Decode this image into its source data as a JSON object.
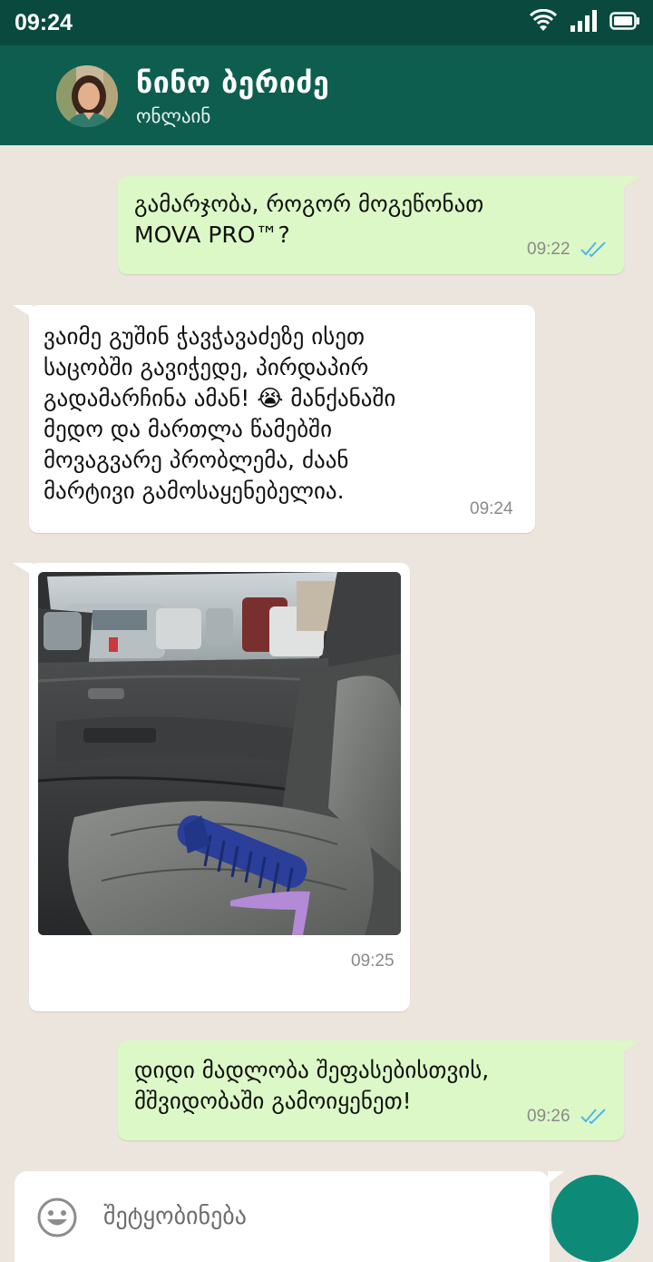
{
  "status_bar": {
    "time": "09:24",
    "icons": [
      "wifi-icon",
      "signal-icon",
      "battery-icon"
    ]
  },
  "contact": {
    "name": "ნინო ბერიძე",
    "status": "ონლაინ",
    "avatar_icon": "avatar-icon"
  },
  "messages": [
    {
      "direction": "outgoing",
      "text": "გამარჯობა, როგორ მოგეწონათ\nMOVA PRO™?",
      "time": "09:22",
      "read": true
    },
    {
      "direction": "incoming",
      "text": "ვაიმე გუშინ ჭავჭავაძეზე ისეთ\nსაცობში გავიჭედე, პირდაპირ\nგადამარჩინა ამან! 😭  მანქანაში\nმედო და მართლა წამებში\nმოვაგვარე პრობლემა, ძაან\nმარტივი გამოსაყენებელია.",
      "time": "09:24"
    },
    {
      "direction": "incoming",
      "type": "image",
      "time": "09:25"
    },
    {
      "direction": "outgoing",
      "text": "დიდი მადლობა შეფასებისთვის,\nმშვიდობაში გამოიყენეთ!",
      "time": "09:26",
      "read": true
    }
  ],
  "composer": {
    "placeholder": "შეტყობინება",
    "emoji_icon": "emoji-icon",
    "send_icon": "send-icon"
  },
  "colors": {
    "header": "#0d5e4f",
    "status_bar": "#0a4a3e",
    "background": "#ece5dd",
    "outgoing": "#dcf8c6",
    "incoming": "#ffffff",
    "ticks": "#4fb6ec",
    "send_button": "#0d8a78"
  }
}
